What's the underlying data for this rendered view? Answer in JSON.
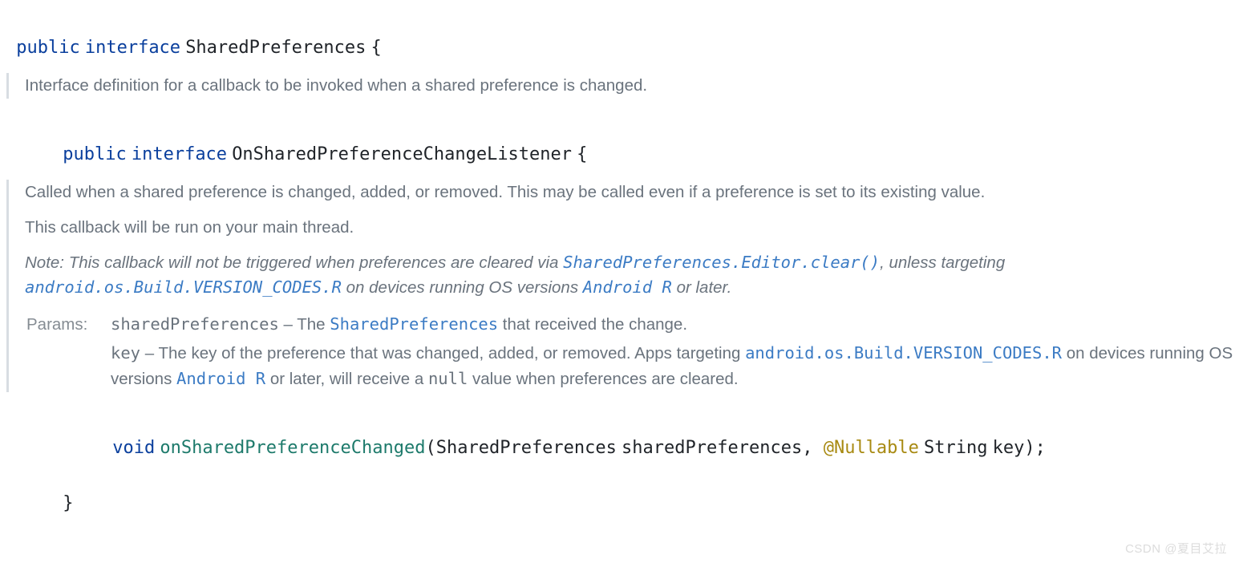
{
  "outer": {
    "kw_public": "public",
    "kw_interface": "interface",
    "name": "SharedPreferences",
    "brace_open": "{",
    "brace_close": "}"
  },
  "outer_doc": "Interface definition for a callback to be invoked when a shared preference is changed.",
  "inner": {
    "kw_public": "public",
    "kw_interface": "interface",
    "name": "OnSharedPreferenceChangeListener",
    "brace_open": "{",
    "brace_close": "}"
  },
  "inner_doc": {
    "p1": "Called when a shared preference is changed, added, or removed. This may be called even if a preference is set to its existing value.",
    "p2": "This callback will be run on your main thread.",
    "note_prefix": "Note: This callback will not be triggered when preferences are cleared via ",
    "note_link1": "SharedPreferences.Editor.clear()",
    "note_mid1": ", unless targeting ",
    "note_link2": "android.os.Build.VERSION_CODES.R",
    "note_mid2": " on devices running OS versions ",
    "note_link3": "Android R",
    "note_suffix": " or later.",
    "params_label": "Params:",
    "param1_name": "sharedPreferences",
    "param1_sep": " – The ",
    "param1_link": "SharedPreferences",
    "param1_rest": " that received the change.",
    "param2_name": "key",
    "param2_sep": " – The key of the preference that was changed, added, or removed. Apps targeting ",
    "param2_link1": "android.os.Build.VERSION_CODES.R",
    "param2_mid": " on devices running OS versions ",
    "param2_link2": "Android R",
    "param2_mid2": " or later, will receive a ",
    "param2_null": "null",
    "param2_rest": " value when preferences are cleared."
  },
  "method": {
    "ret": "void",
    "name": "onSharedPreferenceChanged",
    "paren_open": "(",
    "p1_type": "SharedPreferences",
    "p1_name": "sharedPreferences",
    "comma": ", ",
    "ann": "@Nullable",
    "p2_type": "String",
    "p2_name": "key",
    "paren_close": ")",
    "semi": ";"
  },
  "watermark": "CSDN @夏目艾拉"
}
